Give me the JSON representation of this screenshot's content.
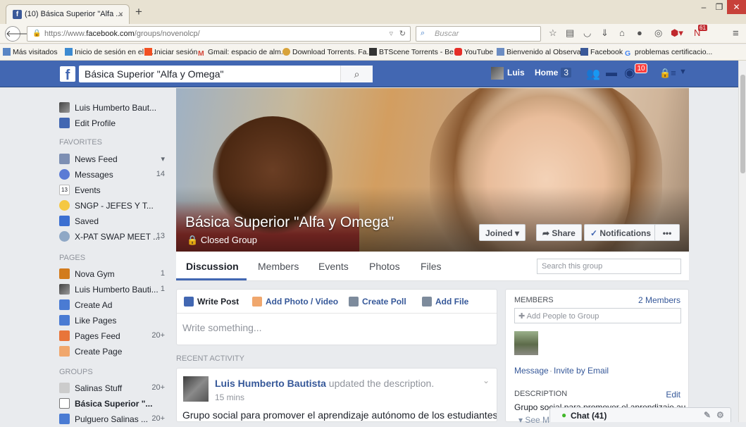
{
  "browser": {
    "tab_title": "(10) Básica Superior \"Alfa ...",
    "tab_close": "×",
    "new_tab": "+",
    "url_prefix": "https://www.",
    "url_domain": "facebook.com",
    "url_path": "/groups/novenolcp/",
    "search_placeholder": "Buscar",
    "window_buttons": [
      "–",
      "❐",
      "✕"
    ],
    "toolbar_badge": "61",
    "bookmarks": [
      "Más visitados",
      "Inicio de sesión en el c...",
      "Iniciar sesión",
      "Gmail: espacio de alm...",
      "Download Torrents. Fa...",
      "BTScene Torrents - Be...",
      "YouTube",
      "Bienvenido al Observa...",
      "Facebook",
      "problemas certificacio..."
    ]
  },
  "fbbar": {
    "search_value": "Básica Superior \"Alfa y Omega\"",
    "user": "Luis",
    "home": "Home",
    "home_count": "3",
    "notif_count": "10"
  },
  "sidebar": {
    "profile_name": "Luis Humberto Baut...",
    "edit_profile": "Edit Profile",
    "favorites_header": "FAVORITES",
    "favorites": [
      {
        "label": "News Feed",
        "count": "▾"
      },
      {
        "label": "Messages",
        "count": "14"
      },
      {
        "label": "Events",
        "count": ""
      },
      {
        "label": "SNGP - JEFES Y T...",
        "count": ""
      },
      {
        "label": "Saved",
        "count": ""
      },
      {
        "label": "X-PAT SWAP MEET ...",
        "count": "13"
      }
    ],
    "pages_header": "PAGES",
    "pages": [
      {
        "label": "Nova Gym",
        "count": "1"
      },
      {
        "label": "Luis Humberto Bauti...",
        "count": "1"
      },
      {
        "label": "Create Ad",
        "count": ""
      },
      {
        "label": "Like Pages",
        "count": ""
      },
      {
        "label": "Pages Feed",
        "count": "20+"
      },
      {
        "label": "Create Page",
        "count": ""
      }
    ],
    "groups_header": "GROUPS",
    "groups": [
      {
        "label": "Salinas Stuff",
        "count": "20+"
      },
      {
        "label": "Básica Superior \"...",
        "count": ""
      },
      {
        "label": "Pulguero Salinas ...",
        "count": "20+"
      }
    ]
  },
  "cover": {
    "group_name": "Básica Superior \"Alfa y Omega\"",
    "privacy": "Closed Group",
    "joined": "Joined ▾",
    "share": "Share",
    "notifications": "Notifications",
    "more": "•••"
  },
  "tabs": {
    "items": [
      "Discussion",
      "Members",
      "Events",
      "Photos",
      "Files"
    ],
    "search_placeholder": "Search this group"
  },
  "composer": {
    "write_post": "Write Post",
    "add_photo": "Add Photo / Video",
    "create_poll": "Create Poll",
    "add_file": "Add File",
    "placeholder": "Write something..."
  },
  "feed": {
    "recent_header": "RECENT ACTIVITY",
    "post": {
      "author": "Luis Humberto Bautista",
      "action": " updated the description.",
      "time": "15 mins",
      "text": "Grupo social para promover el aprendizaje autónomo de los estudiantes de"
    }
  },
  "members": {
    "header": "MEMBERS",
    "count": "2 Members",
    "add_placeholder": "Add People to Group",
    "message": "Message",
    "invite": "Invite by Email",
    "description_header": "DESCRIPTION",
    "edit": "Edit",
    "description": "Grupo social para promover el aprendizaje au...",
    "see_more": "See M"
  },
  "chat": {
    "label": "Chat (41)"
  },
  "colors": {
    "fb_blue": "#4267b2",
    "link": "#365899",
    "badge_red": "#fa3e3e"
  }
}
